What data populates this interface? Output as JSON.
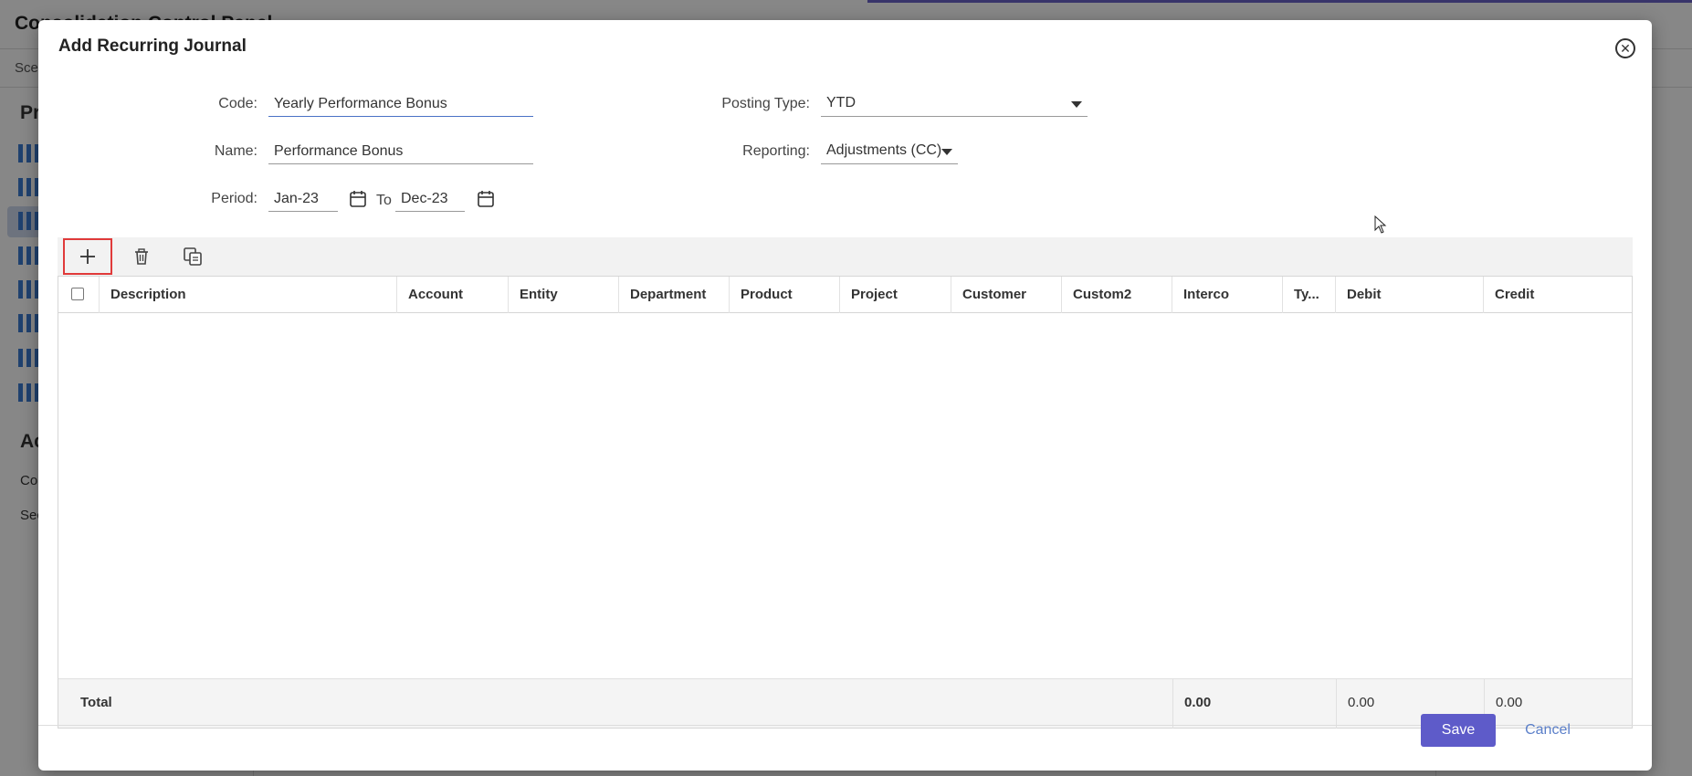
{
  "background": {
    "app_title": "Consolidation Control Panel",
    "sub_text": "Sce",
    "sidebar_heading_1": "Pr",
    "sidebar_heading_2": "Ac",
    "sidebar_link_1": "Co",
    "sidebar_link_2": "Sec"
  },
  "dialog": {
    "title": "Add Recurring Journal",
    "close_icon": "close-circle-icon"
  },
  "form": {
    "code_label": "Code:",
    "code_value": "Yearly Performance Bonus",
    "name_label": "Name:",
    "name_value": "Performance Bonus",
    "period_label": "Period:",
    "period_from": "Jan-23",
    "to_label": "To",
    "period_to": "Dec-23",
    "posting_type_label": "Posting Type:",
    "posting_type_value": "YTD",
    "reporting_label": "Reporting:",
    "reporting_value": "Adjustments (CC)"
  },
  "toolbar": {
    "add_icon": "plus-icon",
    "delete_icon": "trash-icon",
    "copy_icon": "copy-icon"
  },
  "grid": {
    "columns": [
      "Description",
      "Account",
      "Entity",
      "Department",
      "Product",
      "Project",
      "Customer",
      "Custom2",
      "Interco",
      "Ty...",
      "Debit",
      "Credit"
    ],
    "footer": {
      "label": "Total",
      "interco_total": "0.00",
      "debit_total": "0.00",
      "credit_total": "0.00"
    }
  },
  "buttons": {
    "save": "Save",
    "cancel": "Cancel"
  },
  "colors": {
    "accent": "#5e5bc9",
    "highlight": "#e03a3a",
    "link": "#5b7fc9"
  }
}
